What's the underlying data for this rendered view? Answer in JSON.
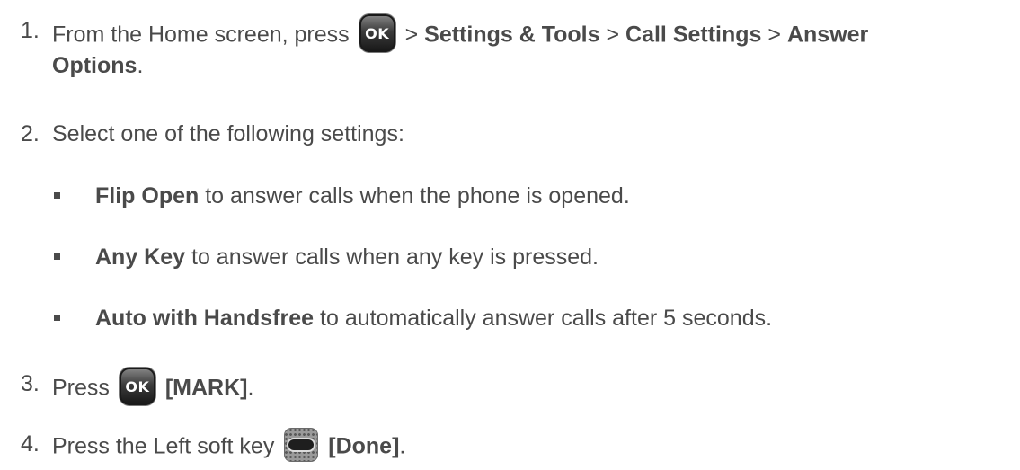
{
  "steps": [
    {
      "num": "1.",
      "prefix": "From the Home screen, press",
      "key_label": "OK",
      "sep1": ">",
      "b1": "Settings & Tools",
      "sep2": ">",
      "b2": "Call Settings",
      "sep3": ">",
      "b3": "Answer",
      "b3_cont": "Options",
      "suffix": "."
    },
    {
      "num": "2.",
      "text": "Select one of the following settings:"
    },
    {
      "num": "3.",
      "prefix": "Press",
      "key_label": "OK",
      "b1": "[MARK]",
      "suffix": "."
    },
    {
      "num": "4.",
      "prefix": "Press the Left soft key",
      "b1": "[Done]",
      "suffix": "."
    }
  ],
  "options": [
    {
      "bold": "Flip Open",
      "text": " to answer calls when the phone is opened."
    },
    {
      "bold": "Any Key",
      "text": " to answer calls when any key is pressed."
    },
    {
      "bold": "Auto with Handsfree",
      "text": " to automatically answer calls after 5 seconds."
    }
  ]
}
